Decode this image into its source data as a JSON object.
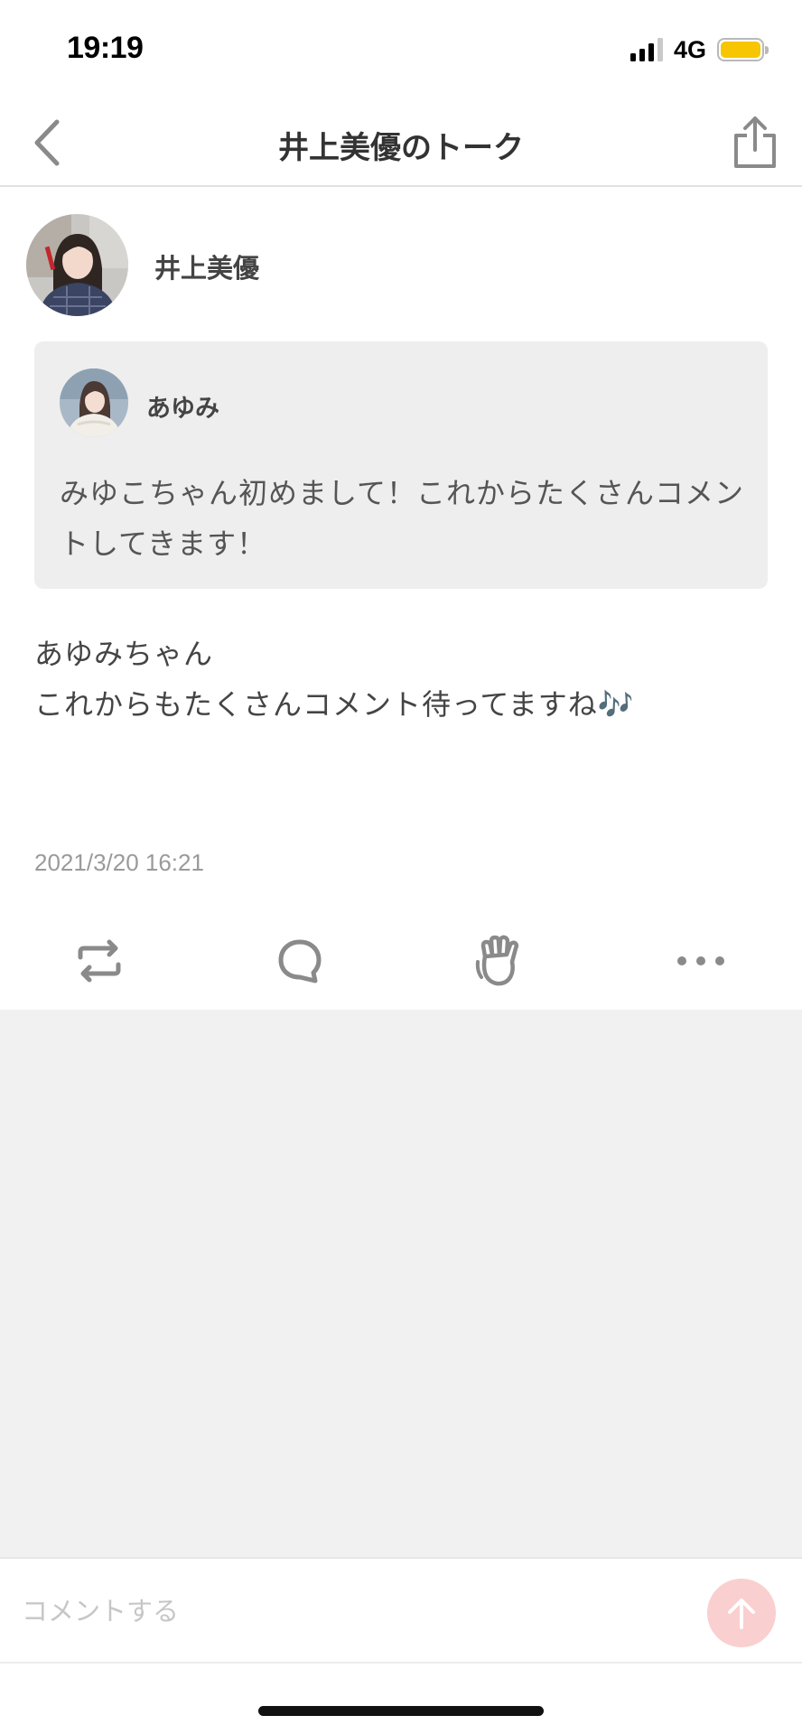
{
  "status_bar": {
    "time": "19:19",
    "network": "4G"
  },
  "header": {
    "title": "井上美優のトーク",
    "back_icon": "chevron-left-icon",
    "share_icon": "share-icon"
  },
  "post": {
    "author": "井上美優",
    "quote": {
      "author": "あゆみ",
      "text": "みゆこちゃん初めまして！これからたくさんコメントしてきます！"
    },
    "reply": "あゆみちゃん\nこれからもたくさんコメント待ってますね🎶",
    "timestamp": "2021/3/20 16:21"
  },
  "actions": [
    "repost-icon",
    "comment-bubble-icon",
    "clap-icon",
    "more-icon"
  ],
  "comment_bar": {
    "placeholder": "コメントする",
    "send_icon": "arrow-up-icon"
  },
  "colors": {
    "send_button": "#f9cfcf",
    "battery": "#f7c600",
    "background_gray": "#f1f1f1",
    "quote_background": "#eeeeee"
  }
}
